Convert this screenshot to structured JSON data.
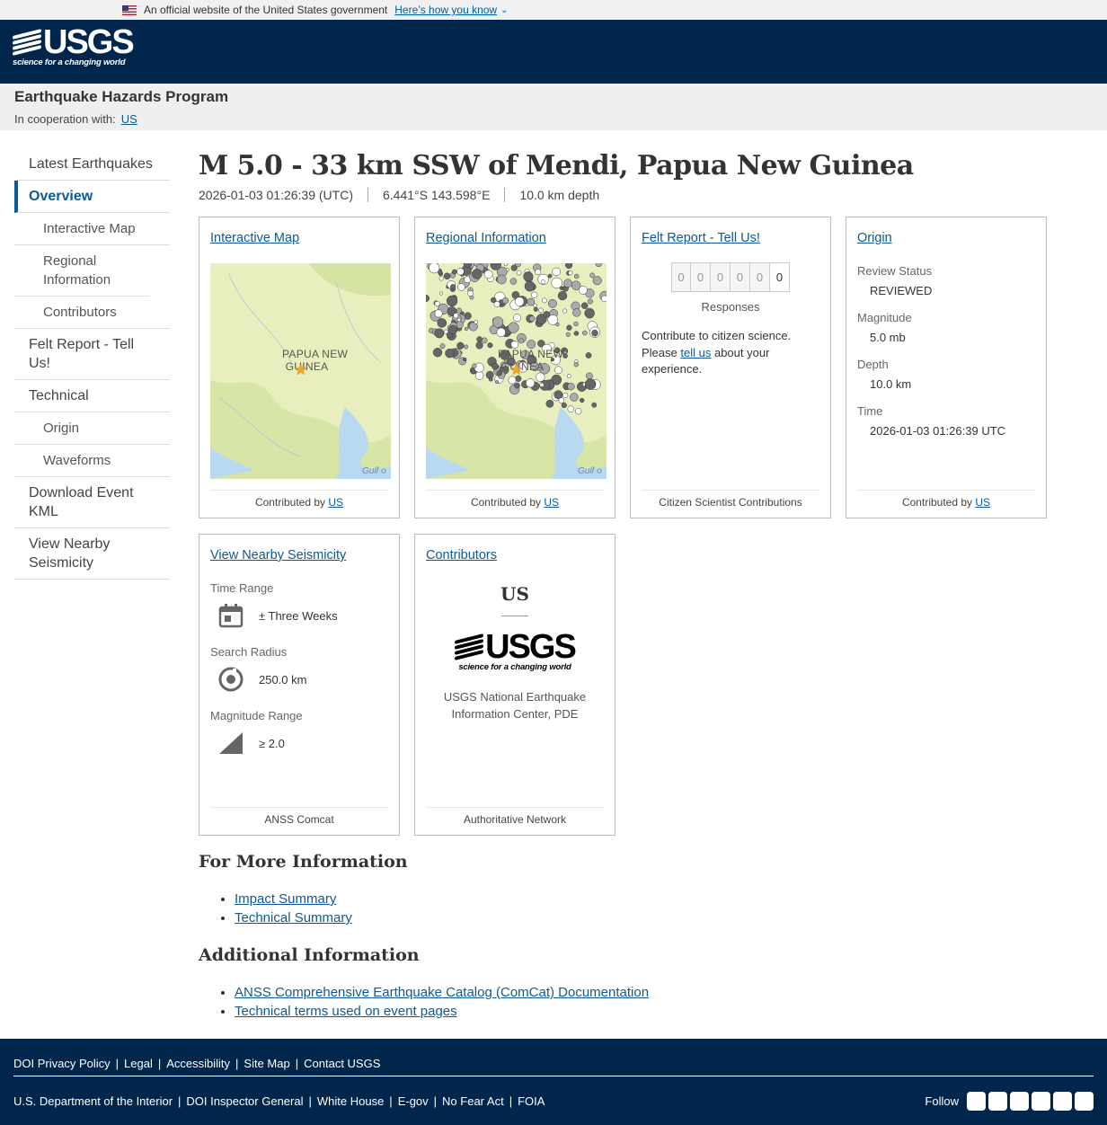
{
  "gov_banner": {
    "text": "An official website of the United States government",
    "link": "Here’s how you know"
  },
  "header": {
    "logo_text": "USGS",
    "logo_tagline": "science for a changing world"
  },
  "site": {
    "title": "Earthquake Hazards Program",
    "coop_label": "In cooperation with:",
    "coop_link": "US"
  },
  "sidebar": {
    "items": [
      {
        "label": "Latest Earthquakes"
      },
      {
        "label": "Overview"
      },
      {
        "label": "Interactive Map"
      },
      {
        "label": "Regional Information"
      },
      {
        "label": "Contributors"
      },
      {
        "label": "Felt Report - Tell Us!"
      },
      {
        "label": "Technical"
      },
      {
        "label": "Origin"
      },
      {
        "label": "Waveforms"
      },
      {
        "label": "Download Event KML"
      },
      {
        "label": "View Nearby Seismicity"
      }
    ]
  },
  "event": {
    "title": "M 5.0 - 33 km SSW of Mendi, Papua New Guinea",
    "time": "2026-01-03 01:26:39 (UTC)",
    "location": "6.441°S 143.598°E",
    "depth": "10.0 km depth"
  },
  "cards": {
    "interactive_map": {
      "title": "Interactive Map",
      "map_label_1": "PAPUA NEW",
      "map_label_2": "GUINEA",
      "gulf": "Gulf o",
      "foot_prefix": "Contributed by",
      "foot_link": "US"
    },
    "regional": {
      "title": "Regional Information",
      "map_label_1": "PAPUA NEW",
      "map_label_2": "GUINEA",
      "gulf": "Gulf o",
      "foot_prefix": "Contributed by",
      "foot_link": "US"
    },
    "felt": {
      "title": "Felt Report - Tell Us!",
      "digits": [
        "0",
        "0",
        "0",
        "0",
        "0",
        "0"
      ],
      "responses_label": "Responses",
      "text_1": "Contribute to citizen science. Please",
      "text_link": "tell us",
      "text_2": "about your experience.",
      "foot": "Citizen Scientist Contributions"
    },
    "origin": {
      "title": "Origin",
      "review_label": "Review Status",
      "review_value": "REVIEWED",
      "magnitude_label": "Magnitude",
      "magnitude_value": "5.0 mb",
      "depth_label": "Depth",
      "depth_value": "10.0 km",
      "time_label": "Time",
      "time_value": "2026-01-03 01:26:39 UTC",
      "foot_prefix": "Contributed by",
      "foot_link": "US"
    },
    "nearby": {
      "title": "View Nearby Seismicity",
      "time_label": "Time Range",
      "time_value": "± Three Weeks",
      "radius_label": "Search Radius",
      "radius_value": "250.0 km",
      "mag_label": "Magnitude Range",
      "mag_value": "≥ 2.0",
      "foot": "ANSS Comcat"
    },
    "contributors": {
      "title": "Contributors",
      "name": "US",
      "logo_text": "USGS",
      "logo_tagline": "science for a changing world",
      "desc_1": "USGS National Earthquake",
      "desc_2": "Information Center, PDE",
      "foot": "Authoritative Network"
    }
  },
  "more_info": {
    "heading": "For More Information",
    "links": [
      "Impact Summary",
      "Technical Summary"
    ]
  },
  "additional_info": {
    "heading": "Additional Information",
    "links": [
      "ANSS Comprehensive Earthquake Catalog (ComCat) Documentation",
      "Technical terms used on event pages"
    ]
  },
  "footer": {
    "row1": [
      "DOI Privacy Policy",
      "Legal",
      "Accessibility",
      "Site Map",
      "Contact USGS"
    ],
    "row2": [
      "U.S. Department of the Interior",
      "DOI Inspector General",
      "White House",
      "E-gov",
      "No Fear Act",
      "FOIA"
    ],
    "follow": "Follow",
    "social_icons": [
      "twitter-icon",
      "facebook-icon",
      "github-icon",
      "flickr-icon",
      "youtube-icon",
      "instagram-icon"
    ]
  },
  "colors": {
    "header_bg": "#00264c",
    "link": "#0b5a95",
    "star": "#f6a31e",
    "map_land": "#e5edb8",
    "map_water": "#b8d9ee"
  }
}
